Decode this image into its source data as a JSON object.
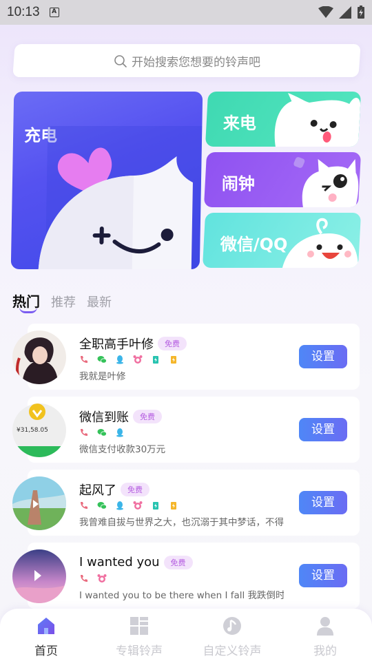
{
  "status_bar": {
    "time": "10:13"
  },
  "search": {
    "placeholder": "开始搜索您想要的铃声吧"
  },
  "categories": {
    "charge": "充电",
    "call": "来电",
    "alarm": "闹钟",
    "wechat": "微信/QQ"
  },
  "tabs": [
    "热门",
    "推荐",
    "最新"
  ],
  "ringtones": [
    {
      "title": "全职高手叶修",
      "badge": "免费",
      "desc": "我就是叶修",
      "button": "设置"
    },
    {
      "title": "微信到账",
      "badge": "免费",
      "desc": "微信支付收款30万元",
      "button": "设置",
      "thumb_text": "¥31,58.05"
    },
    {
      "title": "起风了",
      "badge": "免费",
      "desc": "我曾难自拔与世界之大，也沉溺于其中梦话，不得真假，不做挣扎",
      "button": "设置"
    },
    {
      "title": "I wanted you",
      "badge": "免费",
      "desc": "I wanted you to be there when I fall 我跌倒时要你在我身边",
      "button": "设置"
    }
  ],
  "bottom_nav": {
    "home": "首页",
    "albums": "专辑铃声",
    "custom": "自定义铃声",
    "mine": "我的"
  },
  "colors": {
    "accent": "#6a6cf3",
    "call_card": "#3fd9b2",
    "alarm_card": "#8f52f1",
    "wechat_card": "#61e3de",
    "badge_text": "#b45ce0"
  }
}
